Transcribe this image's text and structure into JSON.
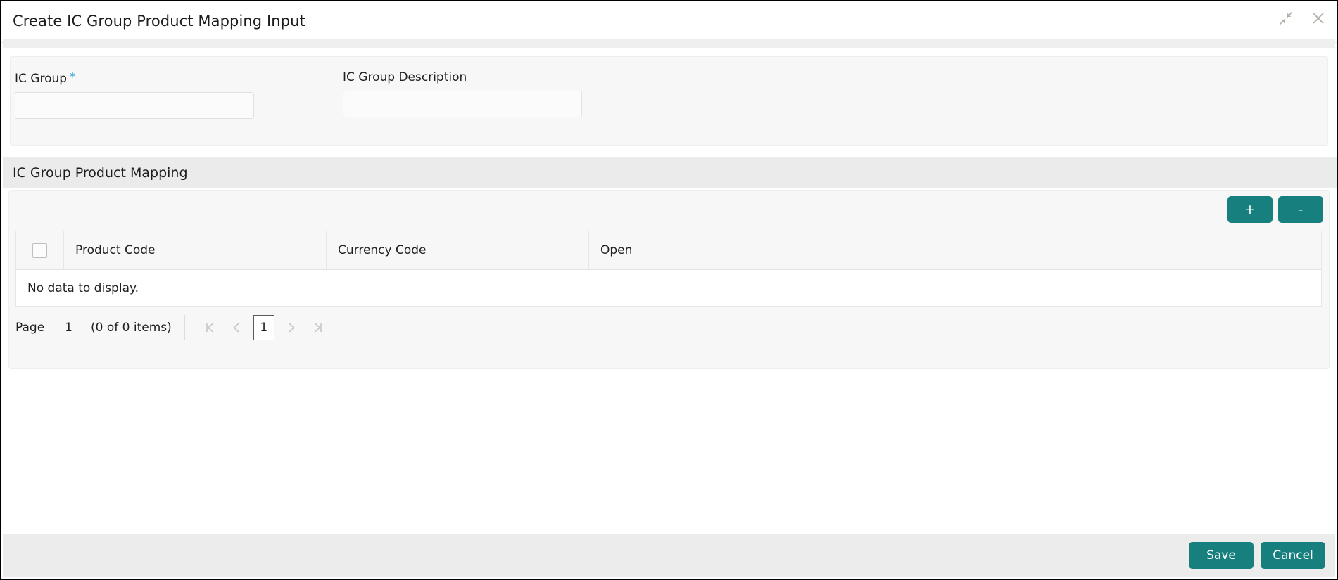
{
  "window": {
    "title": "Create IC Group Product Mapping Input",
    "minimize_icon": "collapse-arrows-icon",
    "close_icon": "close-icon"
  },
  "form": {
    "fields": [
      {
        "label": "IC Group",
        "required": true,
        "required_marker": "*",
        "value": "",
        "placeholder": ""
      },
      {
        "label": "IC Group Description",
        "required": false,
        "required_marker": "",
        "value": "",
        "placeholder": ""
      }
    ]
  },
  "section": {
    "title": "IC Group Product Mapping",
    "add_row_label": "+",
    "remove_row_label": "-"
  },
  "grid": {
    "columns": [
      "Product Code",
      "Currency Code",
      "Open"
    ],
    "select_all_checked": false,
    "rows": [],
    "empty_message": "No data to display."
  },
  "pagination": {
    "page_label": "Page",
    "page_number": "1",
    "items_text": "(0 of 0 items)",
    "first_label": "❘⟨",
    "prev_label": "⟨",
    "current_page": "1",
    "next_label": "⟩",
    "last_label": "⟩❘"
  },
  "footer": {
    "save_label": "Save",
    "cancel_label": "Cancel"
  },
  "colors": {
    "accent_teal": "#17807E",
    "required_star": "#3FA9DE",
    "panel_grey": "#F7F7F7",
    "section_grey": "#EBEBEB",
    "footer_grey": "#ECECEC"
  }
}
